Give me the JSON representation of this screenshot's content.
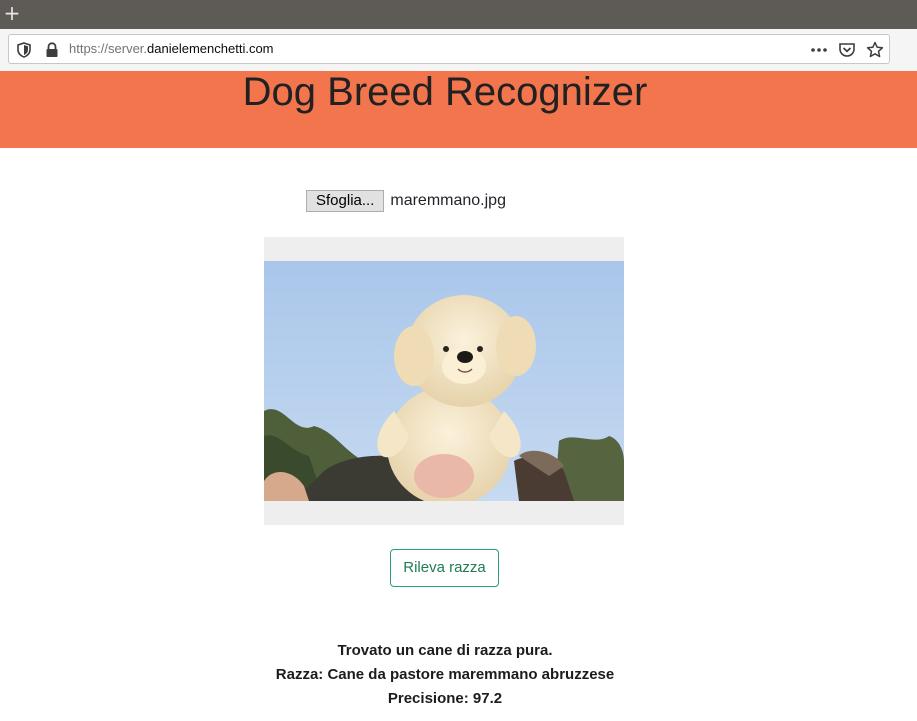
{
  "browser": {
    "new_tab_label": "+",
    "url_scheme": "https://server.",
    "url_domain": "danielemenchetti.com",
    "icons": [
      "shield-icon",
      "lock-icon",
      "more-icon",
      "pocket-icon",
      "star-icon"
    ]
  },
  "header": {
    "title": "Dog Breed Recognizer",
    "bg_color": "#f2754e"
  },
  "upload": {
    "browse_label": "Sfoglia...",
    "file_name": "maremmano.jpg"
  },
  "actions": {
    "detect_label": "Rileva razza",
    "accent_color": "#28a06a"
  },
  "result": {
    "line1": "Trovato un cane di razza pura.",
    "line2": "Razza: Cane da pastore maremmano abruzzese",
    "line3": "Precisione: 97.2"
  }
}
